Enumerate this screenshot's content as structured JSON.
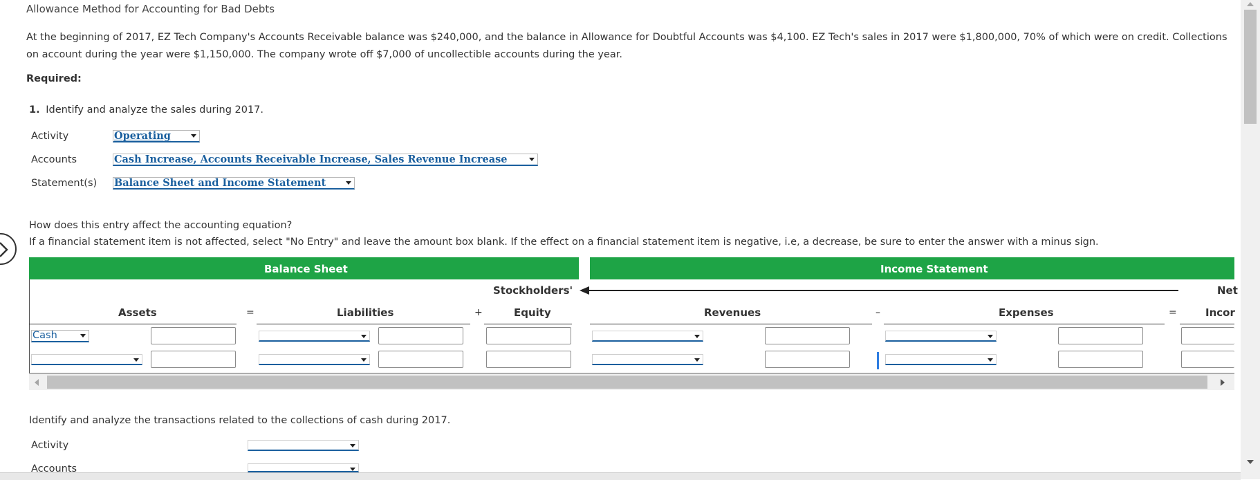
{
  "title": "Allowance Method for Accounting for Bad Debts",
  "problem_text": "At the beginning of 2017, EZ Tech Company's Accounts Receivable balance was $240,000, and the balance in Allowance for Doubtful Accounts was $4,100. EZ Tech's sales in 2017 were $1,800,000, 70% of which were on credit. Collections on account during the year were $1,150,000. The company wrote off $7,000 of uncollectible accounts during the year.",
  "required_label": "Required:",
  "question1": {
    "number": "1.",
    "text": "Identify and analyze the sales during 2017."
  },
  "analysis": {
    "activity_label": "Activity",
    "activity_value": "Operating",
    "accounts_label": "Accounts",
    "accounts_value": "Cash Increase, Accounts Receivable Increase, Sales Revenue Increase",
    "statements_label": "Statement(s)",
    "statements_value": "Balance Sheet and Income Statement"
  },
  "equation": {
    "question": "How does this entry affect the accounting equation?",
    "instruction": "If a financial statement item is not affected, select \"No Entry\" and leave the amount box blank. If the effect on a financial statement item is negative, i.e, a decrease, be sure to enter the answer with a minus sign."
  },
  "table": {
    "balance_sheet": "Balance Sheet",
    "income_statement": "Income Statement",
    "stockholders": "Stockholders'",
    "net": "Net",
    "assets": "Assets",
    "equals1": "=",
    "liabilities": "Liabilities",
    "plus": "+",
    "equity": "Equity",
    "revenues": "Revenues",
    "minus": "–",
    "expenses": "Expenses",
    "equals2": "=",
    "income": "Incor",
    "row1_asset_account": "Cash"
  },
  "question2": {
    "text": "Identify and analyze the transactions related to the collections of cash during 2017.",
    "activity_label": "Activity",
    "accounts_label": "Accounts"
  }
}
